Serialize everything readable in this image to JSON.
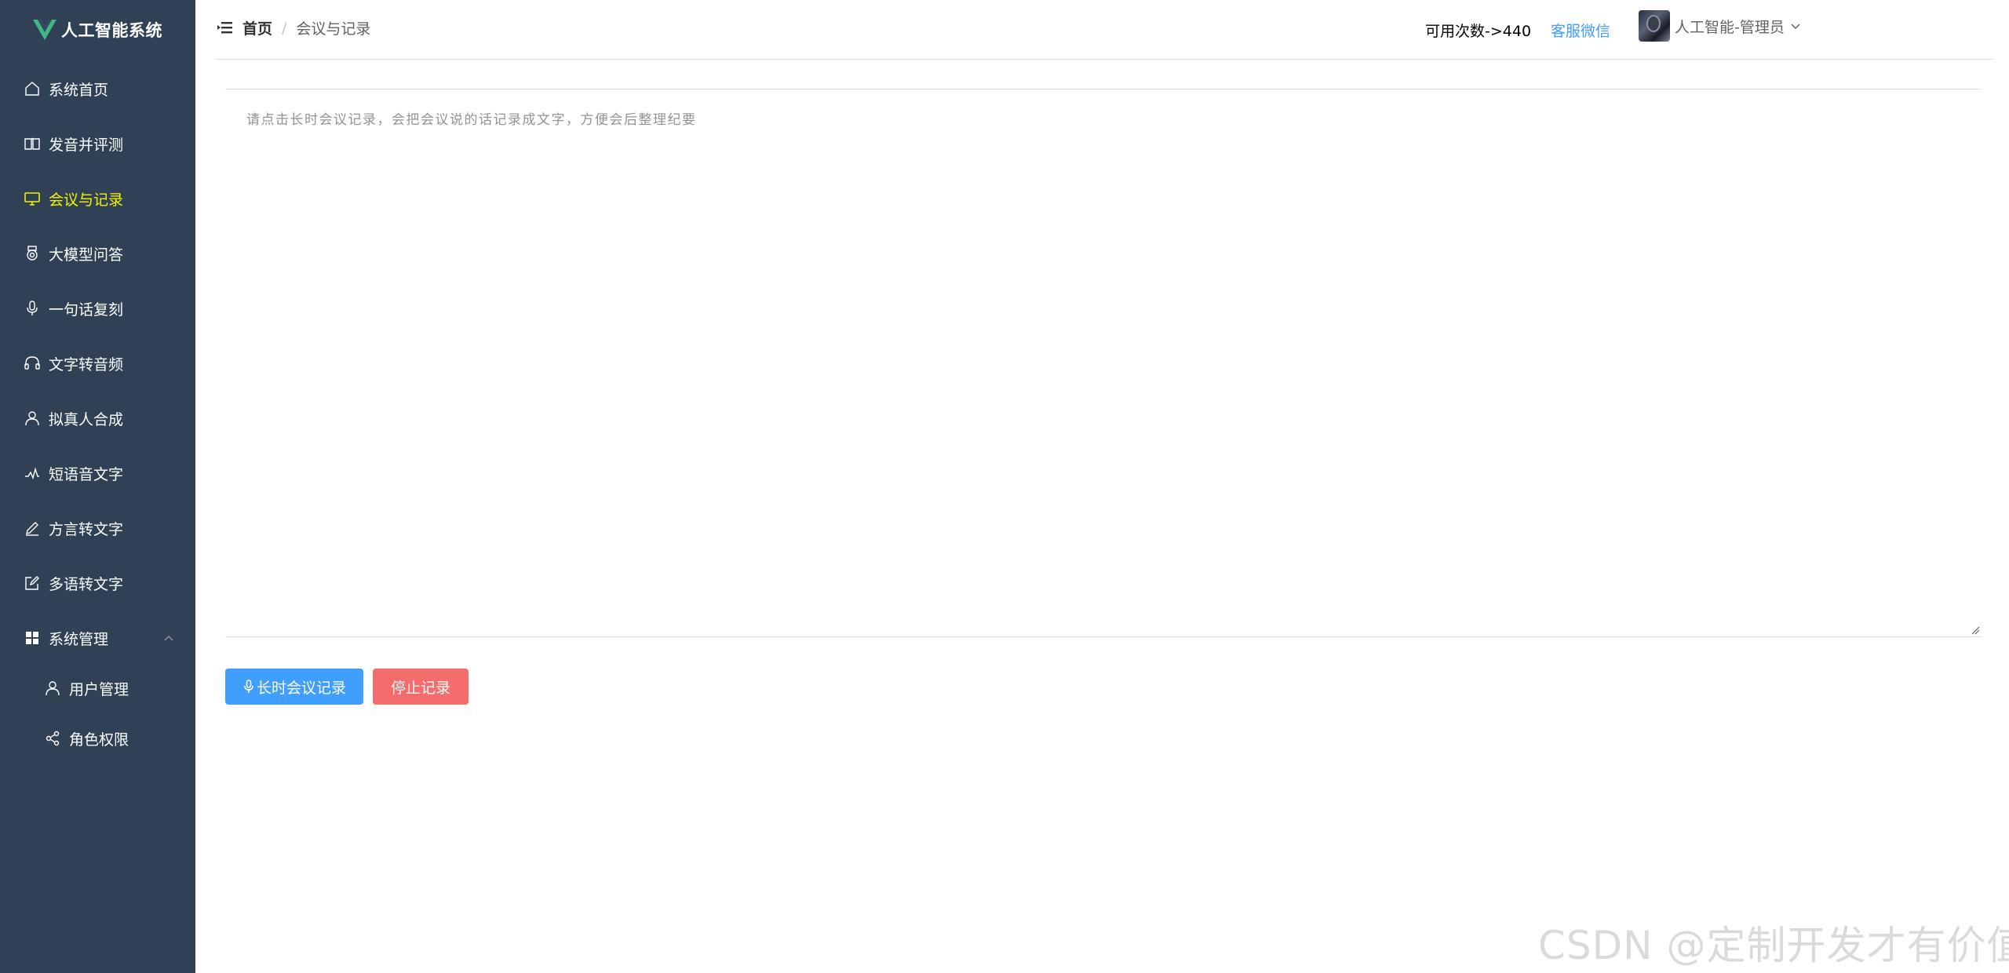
{
  "app": {
    "title": "人工智能系统",
    "colors": {
      "sidebar_bg": "#304156",
      "active_menu": "#f4f400",
      "primary": "#409eff",
      "danger": "#f56c6c"
    }
  },
  "sidebar": {
    "items": [
      {
        "label": "系统首页",
        "icon": "home-icon"
      },
      {
        "label": "发音并评测",
        "icon": "book-icon"
      },
      {
        "label": "会议与记录",
        "icon": "monitor-icon",
        "active": true
      },
      {
        "label": "大模型问答",
        "icon": "medal-icon"
      },
      {
        "label": "一句话复刻",
        "icon": "microphone-icon"
      },
      {
        "label": "文字转音频",
        "icon": "headset-icon"
      },
      {
        "label": "拟真人合成",
        "icon": "user-icon"
      },
      {
        "label": "短语音文字",
        "icon": "audio-wave-icon"
      },
      {
        "label": "方言转文字",
        "icon": "pen-icon"
      },
      {
        "label": "多语转文字",
        "icon": "edit-icon"
      },
      {
        "label": "系统管理",
        "icon": "grid-icon",
        "expanded": true
      }
    ],
    "subitems": [
      {
        "label": "用户管理",
        "icon": "user-icon"
      },
      {
        "label": "角色权限",
        "icon": "share-icon"
      }
    ]
  },
  "header": {
    "breadcrumb": {
      "home": "首页",
      "separator": "/",
      "current": "会议与记录"
    },
    "usage": "可用次数->440",
    "service": "客服微信",
    "user": "人工智能-管理员"
  },
  "main": {
    "notes": {
      "placeholder": "请点击长时会议记录，会把会议说的话记录成文字，方便会后整理纪要",
      "value": ""
    },
    "start_button": "长时会议记录",
    "stop_button": "停止记录"
  },
  "watermark": "CSDN @定制开发才有价值"
}
